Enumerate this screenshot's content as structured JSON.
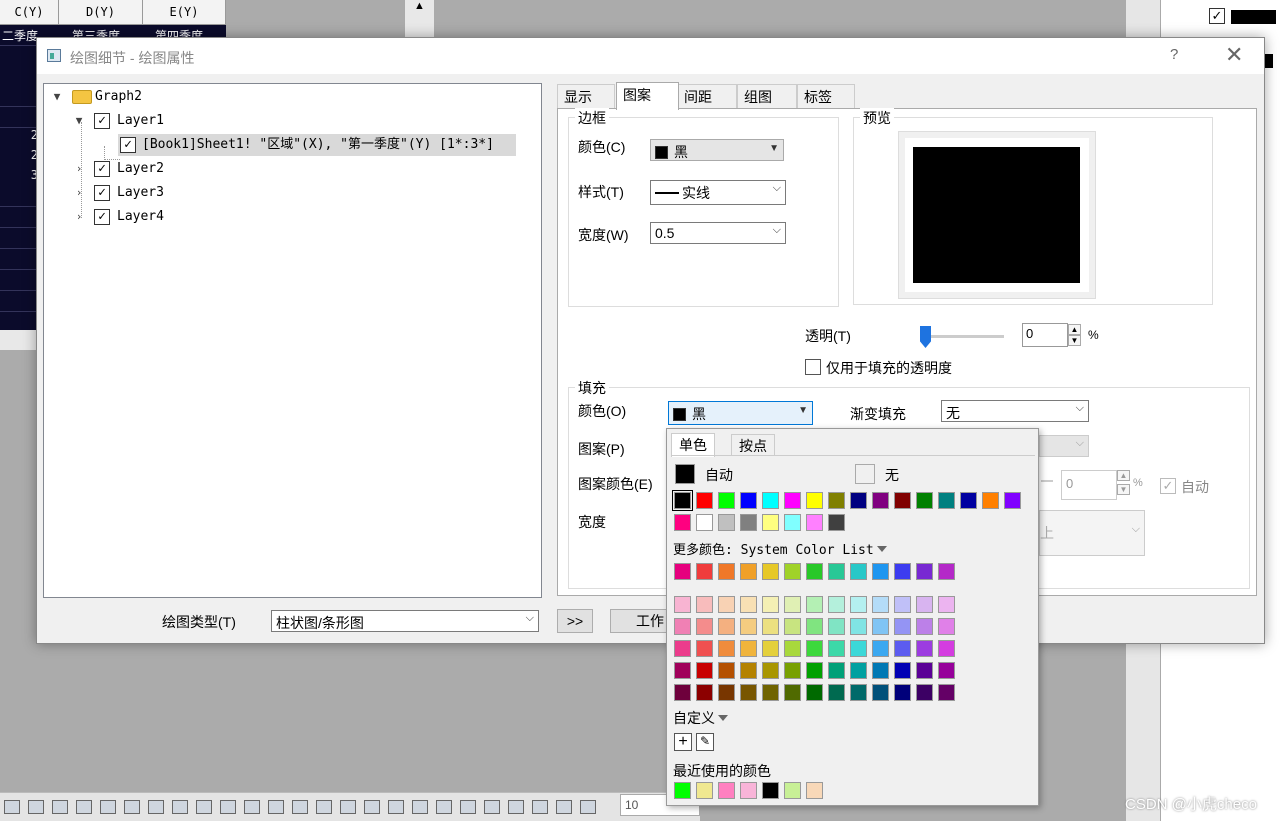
{
  "sheet": {
    "headers": [
      "C(Y)",
      "D(Y)",
      "E(Y)"
    ],
    "row1": [
      "二季度",
      "第三季度",
      "第四季度"
    ],
    "row_numbers": [
      "2",
      "2",
      "3"
    ]
  },
  "dialog": {
    "title": "绘图细节 - 绘图属性",
    "help": "?",
    "close": "✕",
    "tree": {
      "root": "Graph2",
      "layer1": "Layer1",
      "plot": "[Book1]Sheet1! \"区域\"(X), \"第一季度\"(Y) [1*:3*]",
      "layer2": "Layer2",
      "layer3": "Layer3",
      "layer4": "Layer4"
    },
    "plot_type_label": "绘图类型(T)",
    "plot_type_value": "柱状图/条形图",
    "expand_button": ">>",
    "workbook_button": "工作",
    "tabs": [
      "显示",
      "图案",
      "间距",
      "组图",
      "标签"
    ],
    "border": {
      "title": "边框",
      "color_label": "颜色(C)",
      "color_value": "黑",
      "style_label": "样式(T)",
      "style_value": "实线",
      "width_label": "宽度(W)",
      "width_value": "0.5"
    },
    "preview": {
      "title": "预览"
    },
    "transparency_label": "透明(T)",
    "transparency_value": "0",
    "percent": "%",
    "fill_only_label": "仅用于填充的透明度",
    "fill": {
      "title": "填充",
      "color_label": "颜色(O)",
      "color_value": "黑",
      "pattern_label": "图案(P)",
      "pattern_color_label": "图案颜色(E)",
      "width_label": "宽度",
      "gradient_label": "渐变填充",
      "gradient_value": "无",
      "pattern_value": "0",
      "auto_label": "自动",
      "pattern_hint": "上"
    }
  },
  "popup": {
    "tabs": [
      "单色",
      "按点"
    ],
    "auto_label": "自动",
    "none_label": "无",
    "more_colors": "更多颜色: System Color List",
    "custom": "自定义",
    "add": "+",
    "eyedropper": "✎",
    "recent": "最近使用的颜色",
    "basic_colors": [
      "#000000",
      "#ff0000",
      "#00ff00",
      "#0000ff",
      "#00ffff",
      "#ff00ff",
      "#ffff00",
      "#808000",
      "#000080",
      "#800080",
      "#800000",
      "#008000",
      "#008080",
      "#0000a0",
      "#ff8000",
      "#8000ff",
      "#ff0080",
      "#ffffff",
      "#c0c0c0",
      "#808080",
      "#ffff80",
      "#80ffff",
      "#ff80ff",
      "#404040"
    ],
    "system_row": [
      "#e6007e",
      "#f03c3c",
      "#f07828",
      "#f0a028",
      "#e6c828",
      "#a0d228",
      "#28c828",
      "#28c896",
      "#28c8c8",
      "#1e96f0",
      "#3c3cf0",
      "#7828d2",
      "#b428c8"
    ],
    "shade_rows": [
      [
        "#f8b4d2",
        "#f8bcbc",
        "#f8d2b4",
        "#f8e0b4",
        "#f4f0b4",
        "#e0f0b4",
        "#b4f0b4",
        "#b4f0dc",
        "#b4f0f0",
        "#b4dcf8",
        "#c0c0f8",
        "#d8b4f0",
        "#ecb4f0"
      ],
      [
        "#f080b4",
        "#f48c8c",
        "#f4b080",
        "#f4cc80",
        "#ece080",
        "#c8e480",
        "#80e480",
        "#80e4c4",
        "#80e4e4",
        "#80c4f4",
        "#9494f4",
        "#bc80e8",
        "#e080e8"
      ],
      [
        "#ec3c8c",
        "#f05050",
        "#f08c3c",
        "#f0b43c",
        "#e4d03c",
        "#a8d83c",
        "#3cd83c",
        "#3cd8a8",
        "#3cd8d8",
        "#3ca8f0",
        "#5c5cf0",
        "#9c3ce0",
        "#d43ce0"
      ],
      [
        "#a0005a",
        "#c80000",
        "#b45000",
        "#b48200",
        "#a89600",
        "#78a000",
        "#00a000",
        "#00a078",
        "#00a0a0",
        "#0078b4",
        "#0000b4",
        "#5a0096",
        "#96009a"
      ],
      [
        "#6e003c",
        "#8c0000",
        "#783600",
        "#785600",
        "#706400",
        "#506a00",
        "#006a00",
        "#006a50",
        "#006a6a",
        "#00507a",
        "#00007a",
        "#3c0064",
        "#640066"
      ]
    ],
    "recent_colors": [
      "#00ff00",
      "#f0e890",
      "#ff80c0",
      "#f8b4d8",
      "#000000",
      "#c8f096",
      "#f8d8b8"
    ]
  },
  "toolbar": {
    "zoom": "10"
  },
  "watermark": "CSDN @小虎checo"
}
